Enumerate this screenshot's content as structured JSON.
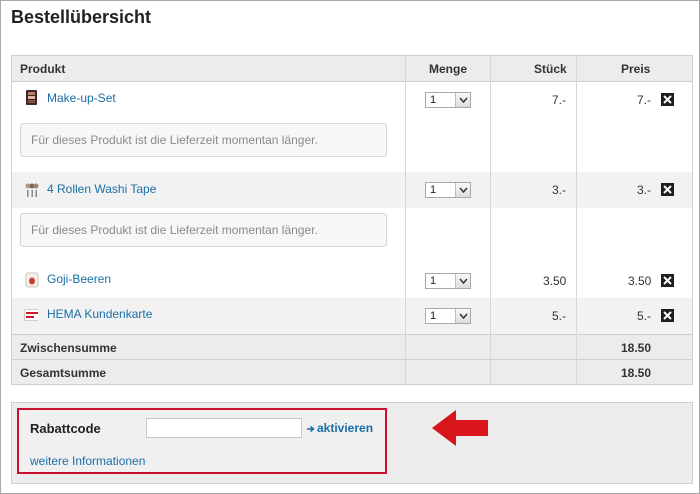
{
  "page": {
    "title": "Bestellübersicht"
  },
  "table": {
    "columns": {
      "product": "Produkt",
      "quantity": "Menge",
      "unit": "Stück",
      "price": "Preis"
    },
    "items": [
      {
        "name": "Make-up-Set",
        "icon": "makeup-set-icon",
        "quantity": "1",
        "unit_price": "7.-",
        "price": "7.-",
        "notice": "Für dieses Produkt ist die Lieferzeit momentan länger."
      },
      {
        "name": "4 Rollen Washi Tape",
        "icon": "washi-tape-icon",
        "quantity": "1",
        "unit_price": "3.-",
        "price": "3.-",
        "notice": "Für dieses Produkt ist die Lieferzeit momentan länger."
      },
      {
        "name": "Goji-Beeren",
        "icon": "goji-berries-icon",
        "quantity": "1",
        "unit_price": "3.50",
        "price": "3.50"
      },
      {
        "name": "HEMA Kundenkarte",
        "icon": "customer-card-icon",
        "quantity": "1",
        "unit_price": "5.-",
        "price": "5.-"
      }
    ],
    "subtotal": {
      "label": "Zwischensumme",
      "value": "18.50"
    },
    "total": {
      "label": "Gesamtsumme",
      "value": "18.50"
    }
  },
  "discount": {
    "label": "Rabattcode",
    "input_value": "",
    "activate_label": "aktivieren",
    "more_info_label": "weitere Informationen"
  },
  "colors": {
    "link": "#1a6fa8",
    "highlight": "#c8102e",
    "arrow": "#d9141b"
  }
}
